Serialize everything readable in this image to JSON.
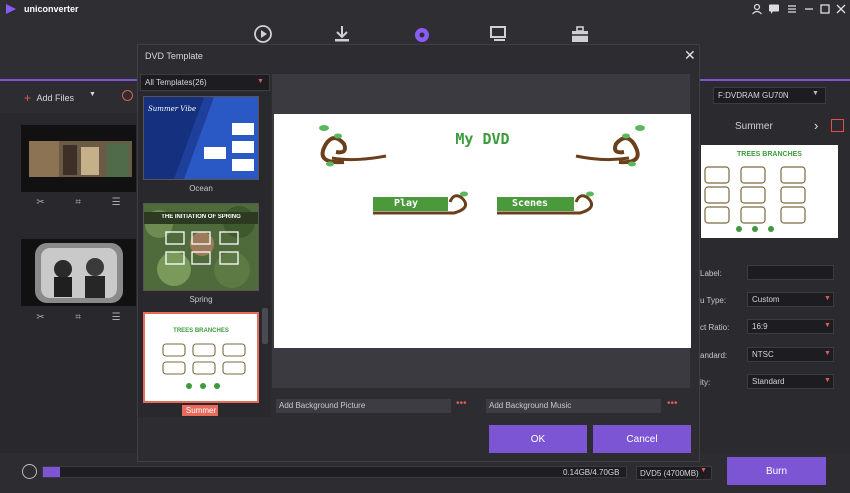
{
  "app": {
    "name": "uniconverter"
  },
  "toolbar": {
    "add_files_label": "Add Files"
  },
  "right_pane": {
    "drive_value": "F:DVDRAM GU70N",
    "template_name": "Summer",
    "props": [
      {
        "label": "Label:",
        "value": ""
      },
      {
        "label": "u Type:",
        "value": "Custom"
      },
      {
        "label": "ct Ratio:",
        "value": "16:9"
      },
      {
        "label": "andard:",
        "value": "NTSC"
      },
      {
        "label": "ity:",
        "value": "Standard"
      }
    ],
    "preview_title": "TREES BRANCHES"
  },
  "bottom": {
    "progress_text": "0.14GB/4.70GB",
    "disc_type": "DVD5 (4700MB)",
    "burn_label": "Burn",
    "progress_fraction": 0.03
  },
  "dialog": {
    "title": "DVD Template",
    "filter_value": "All Templates(26)",
    "templates": [
      {
        "name": "Ocean",
        "banner": "Summer Vibe"
      },
      {
        "name": "Spring",
        "banner": "The initiation of spring"
      },
      {
        "name": "Summer",
        "banner": "TREES BRANCHES"
      }
    ],
    "preview": {
      "title": "My DVD",
      "play": "Play",
      "scenes": "Scenes"
    },
    "bg_picture": "Add Background Picture",
    "bg_music": "Add Background Music",
    "ok_label": "OK",
    "cancel_label": "Cancel"
  },
  "colors": {
    "accent": "#7c55d4",
    "danger": "#e05a5a",
    "green": "#4caf50"
  }
}
